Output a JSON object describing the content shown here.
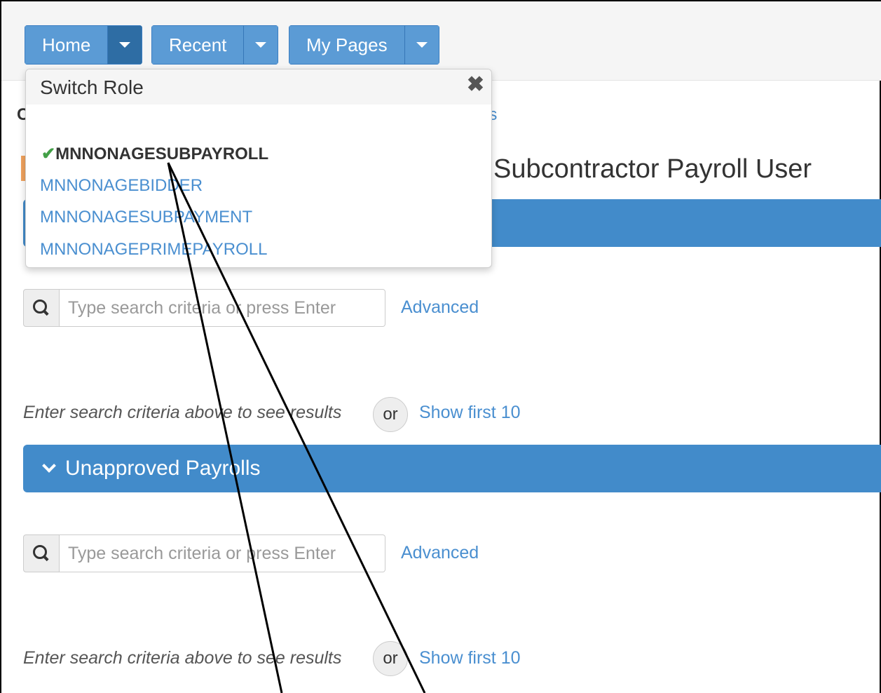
{
  "nav": {
    "home_label": "Home",
    "recent_label": "Recent",
    "mypages_label": "My Pages"
  },
  "breadcrumb": {
    "leading": "C",
    "trailing": "ls"
  },
  "page_title": "Subcontractor Payroll User",
  "switch_role": {
    "title": "Switch Role",
    "roles": [
      {
        "label": "MNNONAGESUBPAYROLL",
        "selected": true
      },
      {
        "label": "MNNONAGEBIDDER",
        "selected": false
      },
      {
        "label": "MNNONAGESUBPAYMENT",
        "selected": false
      },
      {
        "label": "MNNONAGEPRIMEPAYROLL",
        "selected": false
      }
    ]
  },
  "panels": [
    {
      "title": "",
      "search_placeholder": "Type search criteria or press Enter",
      "advanced_label": "Advanced",
      "hint": "Enter search criteria above to see results",
      "or_label": "or",
      "show_label": "Show first 10"
    },
    {
      "title": "Unapproved Payrolls",
      "search_placeholder": "Type search criteria or press Enter",
      "advanced_label": "Advanced",
      "hint": "Enter search criteria above to see results",
      "or_label": "or",
      "show_label": "Show first 10"
    }
  ],
  "icons": {
    "check": "check-icon",
    "close": "close-icon",
    "search": "search-icon",
    "caret": "caret-down-icon",
    "chevron": "chevron-down-icon"
  },
  "colors": {
    "primary": "#428bca",
    "button": "#5b9bd5",
    "link": "#4a8fd0",
    "check": "#43a047",
    "accent_bar": "#f0a35e"
  }
}
